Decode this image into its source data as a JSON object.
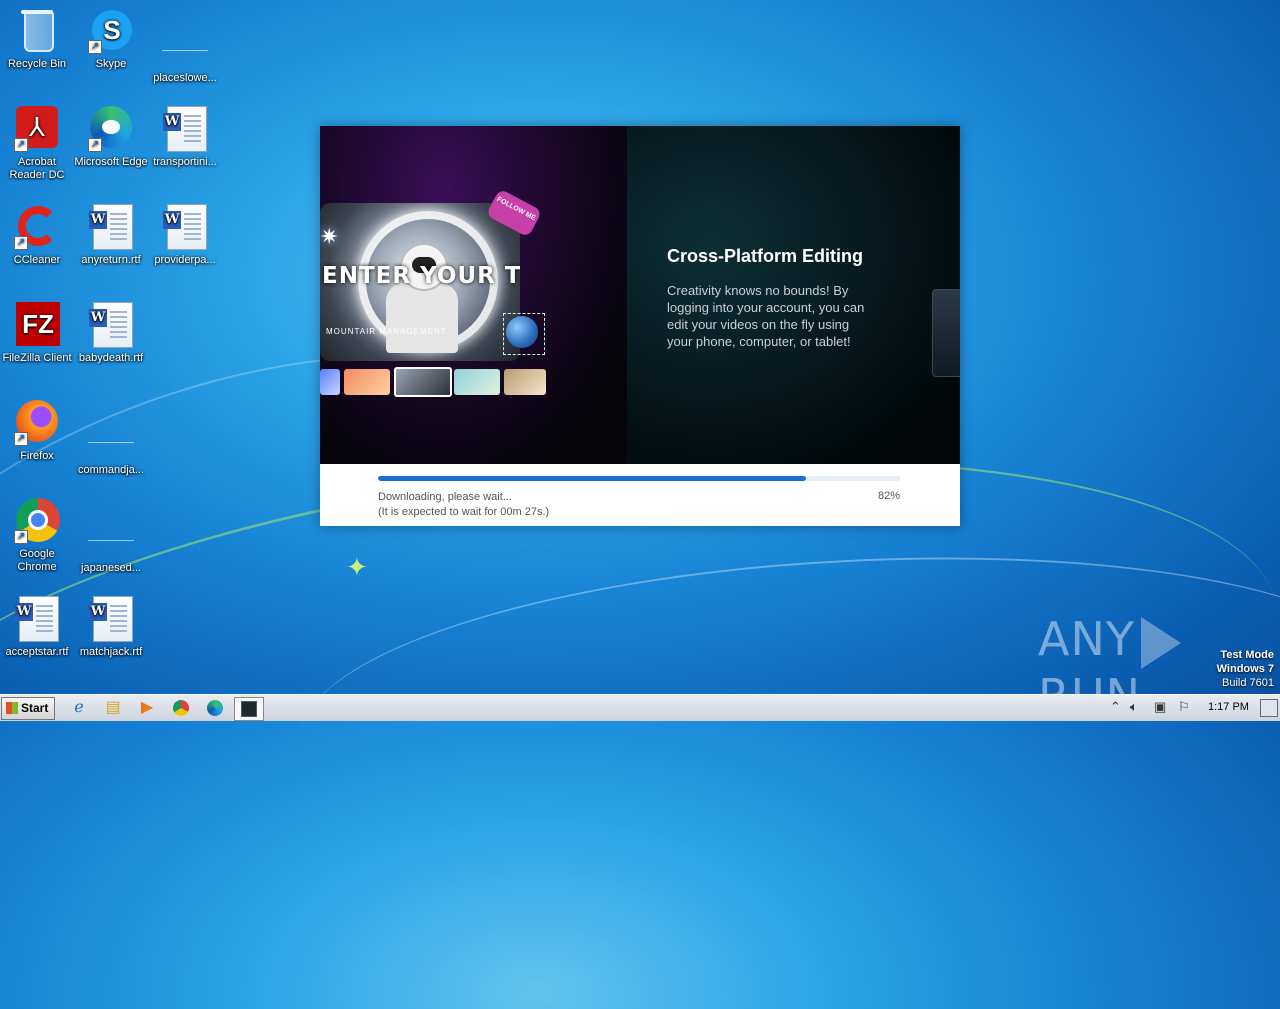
{
  "desktop": {
    "icons": [
      {
        "label": "Recycle Bin"
      },
      {
        "label": "Skype"
      },
      {
        "label": "placeslowe..."
      },
      {
        "label": "Acrobat Reader DC"
      },
      {
        "label": "Microsoft Edge"
      },
      {
        "label": "transportini..."
      },
      {
        "label": "CCleaner"
      },
      {
        "label": "anyreturn.rtf"
      },
      {
        "label": "providerpa..."
      },
      {
        "label": "FileZilla Client"
      },
      {
        "label": "babydeath.rtf"
      },
      {
        "label": "Firefox"
      },
      {
        "label": "commandja..."
      },
      {
        "label": "Google Chrome"
      },
      {
        "label": "japanesed..."
      },
      {
        "label": "acceptstar.rtf"
      },
      {
        "label": "matchjack.rtf"
      }
    ]
  },
  "installer": {
    "preview": {
      "title_text": "ENTER YOUR TITLE",
      "subtitle_text": "MOUNTAIR MANAGEMENT",
      "badge_text": "FOLLOW ME"
    },
    "feature_title": "Cross-Platform Editing",
    "feature_description": "Creativity knows no bounds! By logging into your account, you can edit your videos on the fly using your phone, computer, or tablet!",
    "status_text": "Downloading, please wait...",
    "eta_text": "(It is expected to wait for 00m 27s.)",
    "progress_percent_label": "82%",
    "progress_value": 0.82,
    "accent_color": "#1d6fd6"
  },
  "watermark": {
    "brand_left": "ANY",
    "brand_right": "RUN",
    "test_mode": "Test Mode",
    "os_name": "Windows 7",
    "build": "Build 7601"
  },
  "taskbar": {
    "start_label": "Start",
    "pinned": [
      "internet-explorer-icon",
      "file-explorer-icon",
      "media-player-icon",
      "chrome-icon",
      "edge-icon",
      "installer-app-icon"
    ],
    "clock": "1:17 PM"
  }
}
